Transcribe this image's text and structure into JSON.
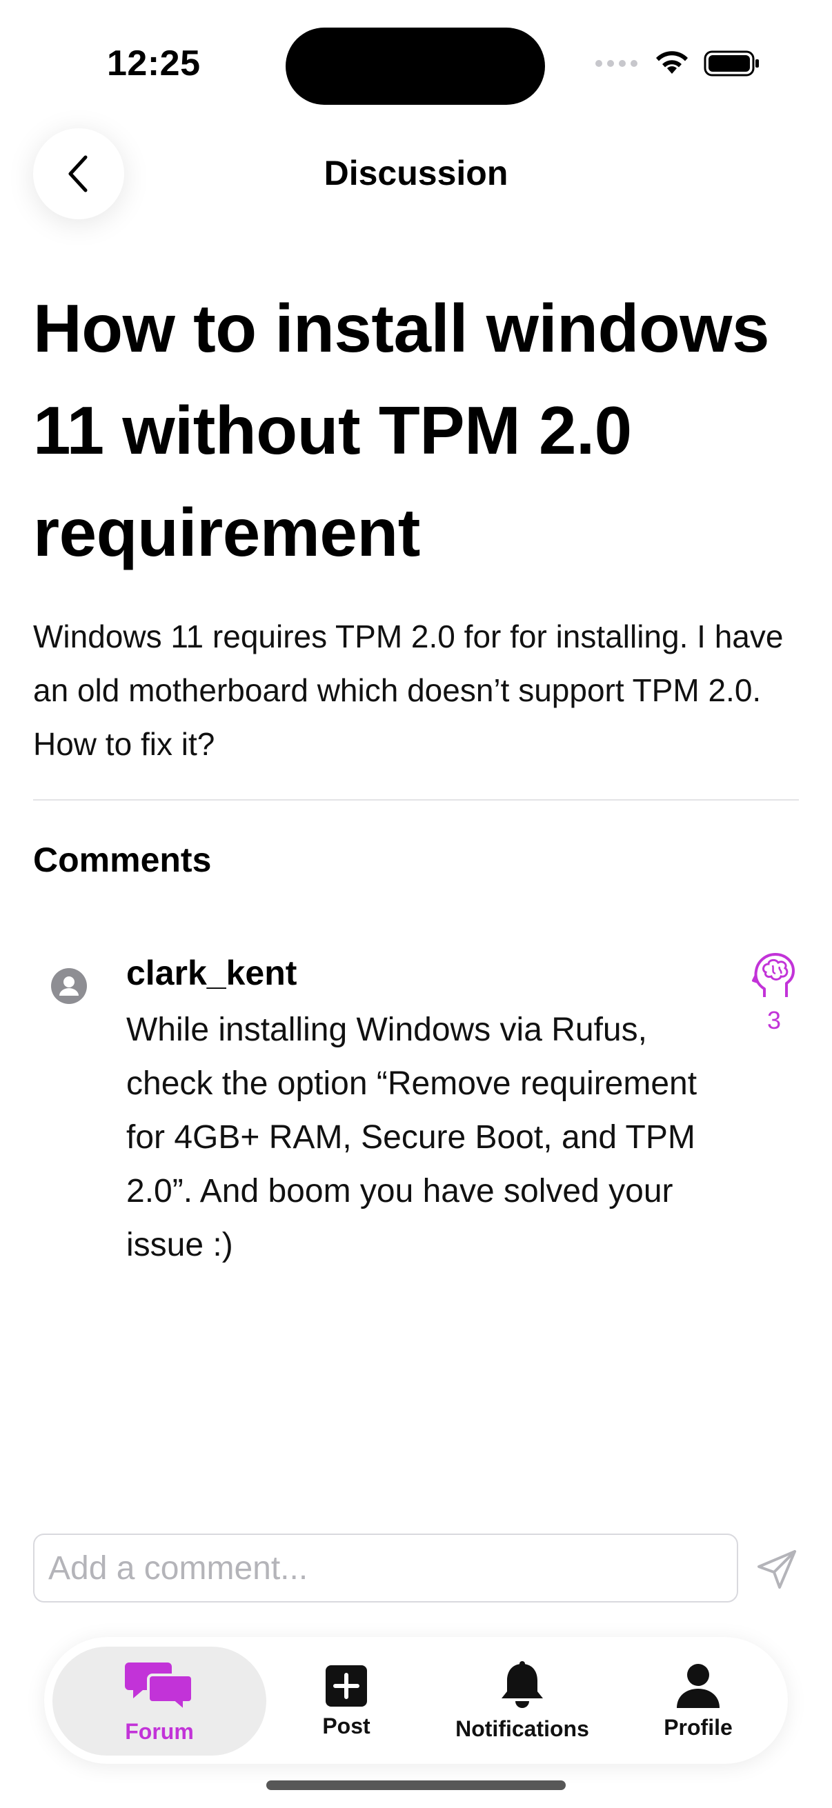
{
  "status_bar": {
    "time": "12:25"
  },
  "header": {
    "title": "Discussion"
  },
  "post": {
    "title": "How to install windows 11 without TPM 2.0 requirement",
    "body": "Windows 11 requires TPM 2.0 for for installing. I have an old motherboard which doesn’t support TPM 2.0. How to fix it?"
  },
  "comments": {
    "heading": "Comments",
    "items": [
      {
        "author": "clark_kent",
        "text": "While installing Windows via Rufus, check the option “Remove requirement for 4GB+ RAM, Secure Boot, and TPM 2.0”. And boom you have solved your issue :)",
        "brain_count": "3",
        "brain_icon": "brain-head-icon"
      }
    ]
  },
  "comment_input": {
    "placeholder": "Add a comment...",
    "value": ""
  },
  "tab_bar": {
    "tabs": [
      {
        "label": "Forum",
        "icon": "chat-bubbles-icon",
        "active": true
      },
      {
        "label": "Post",
        "icon": "plus-square-icon",
        "active": false
      },
      {
        "label": "Notifications",
        "icon": "bell-icon",
        "active": false
      },
      {
        "label": "Profile",
        "icon": "person-icon",
        "active": false
      }
    ]
  },
  "colors": {
    "accent": "#c233d8",
    "text": "#000000",
    "muted": "#b4b4b9",
    "active_tab_bg": "#ececec"
  }
}
